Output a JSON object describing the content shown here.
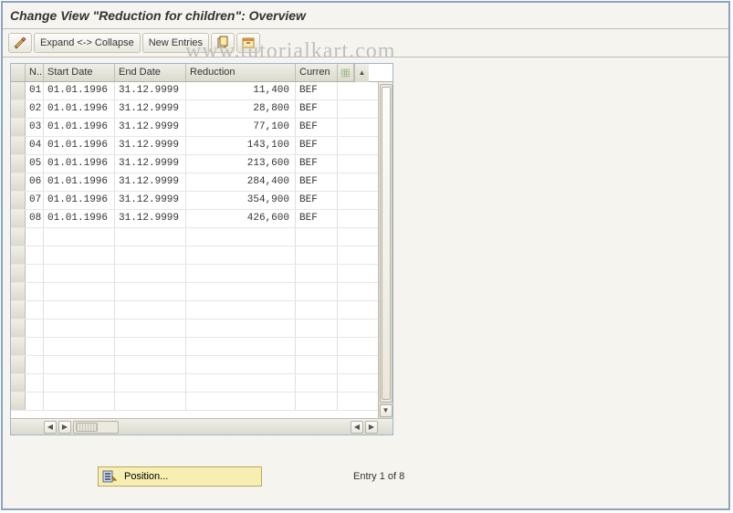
{
  "title": "Change View \"Reduction for children\": Overview",
  "toolbar": {
    "expand_collapse_label": "Expand <-> Collapse",
    "new_entries_label": "New Entries"
  },
  "watermark": "www.tutorialkart.com",
  "grid": {
    "headers": {
      "num": "N..",
      "start": "Start Date",
      "end": "End Date",
      "reduction": "Reduction",
      "currency": "Curren"
    },
    "rows": [
      {
        "num": "01",
        "start": "01.01.1996",
        "end": "31.12.9999",
        "reduction": "11,400",
        "currency": "BEF"
      },
      {
        "num": "02",
        "start": "01.01.1996",
        "end": "31.12.9999",
        "reduction": "28,800",
        "currency": "BEF"
      },
      {
        "num": "03",
        "start": "01.01.1996",
        "end": "31.12.9999",
        "reduction": "77,100",
        "currency": "BEF"
      },
      {
        "num": "04",
        "start": "01.01.1996",
        "end": "31.12.9999",
        "reduction": "143,100",
        "currency": "BEF"
      },
      {
        "num": "05",
        "start": "01.01.1996",
        "end": "31.12.9999",
        "reduction": "213,600",
        "currency": "BEF"
      },
      {
        "num": "06",
        "start": "01.01.1996",
        "end": "31.12.9999",
        "reduction": "284,400",
        "currency": "BEF"
      },
      {
        "num": "07",
        "start": "01.01.1996",
        "end": "31.12.9999",
        "reduction": "354,900",
        "currency": "BEF"
      },
      {
        "num": "08",
        "start": "01.01.1996",
        "end": "31.12.9999",
        "reduction": "426,600",
        "currency": "BEF"
      }
    ],
    "empty_rows": 10
  },
  "footer": {
    "position_label": "Position...",
    "entry_label": "Entry 1 of 8"
  }
}
